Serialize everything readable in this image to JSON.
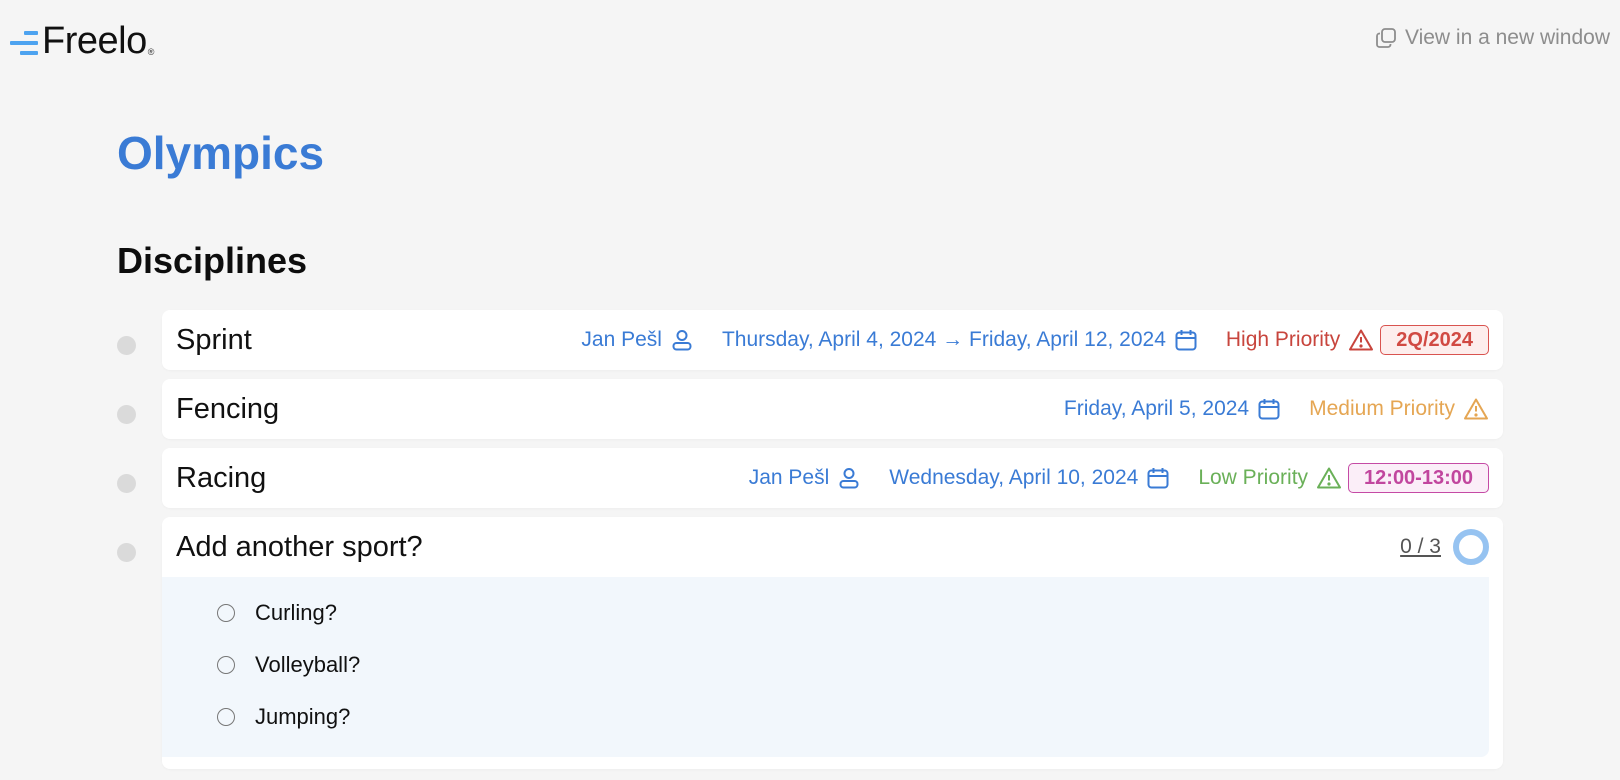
{
  "header": {
    "logo_text": "Freelo",
    "logo_reg": "®",
    "new_window_label": "View in a new window",
    "new_window_icon": "copy-window-icon"
  },
  "page": {
    "title": "Olympics",
    "section_title": "Disciplines"
  },
  "colors": {
    "accent": "#3a7bd5",
    "high_priority": "#c8453d",
    "medium_priority": "#e5a653",
    "low_priority": "#6ab058",
    "tag_pink": "#c1469e",
    "progress_ring": "#96c3f1"
  },
  "tasks": [
    {
      "title": "Sprint",
      "assignee": "Jan Pešl",
      "date": "Thursday, April 4, 2024 → Friday, April 12, 2024",
      "priority": "High Priority",
      "tag": "2Q/2024"
    },
    {
      "title": "Fencing",
      "date": "Friday, April 5, 2024",
      "priority": "Medium Priority"
    },
    {
      "title": "Racing",
      "assignee": "Jan Pešl",
      "date": "Wednesday, April 10, 2024",
      "priority": "Low Priority",
      "tag": "12:00-13:00"
    },
    {
      "title": "Add another sport?",
      "progress": "0 / 3",
      "progress_done": 0,
      "progress_total": 3,
      "subtasks": [
        {
          "label": "Curling?",
          "done": false
        },
        {
          "label": "Volleyball?",
          "done": false
        },
        {
          "label": "Jumping?",
          "done": false
        }
      ]
    }
  ]
}
